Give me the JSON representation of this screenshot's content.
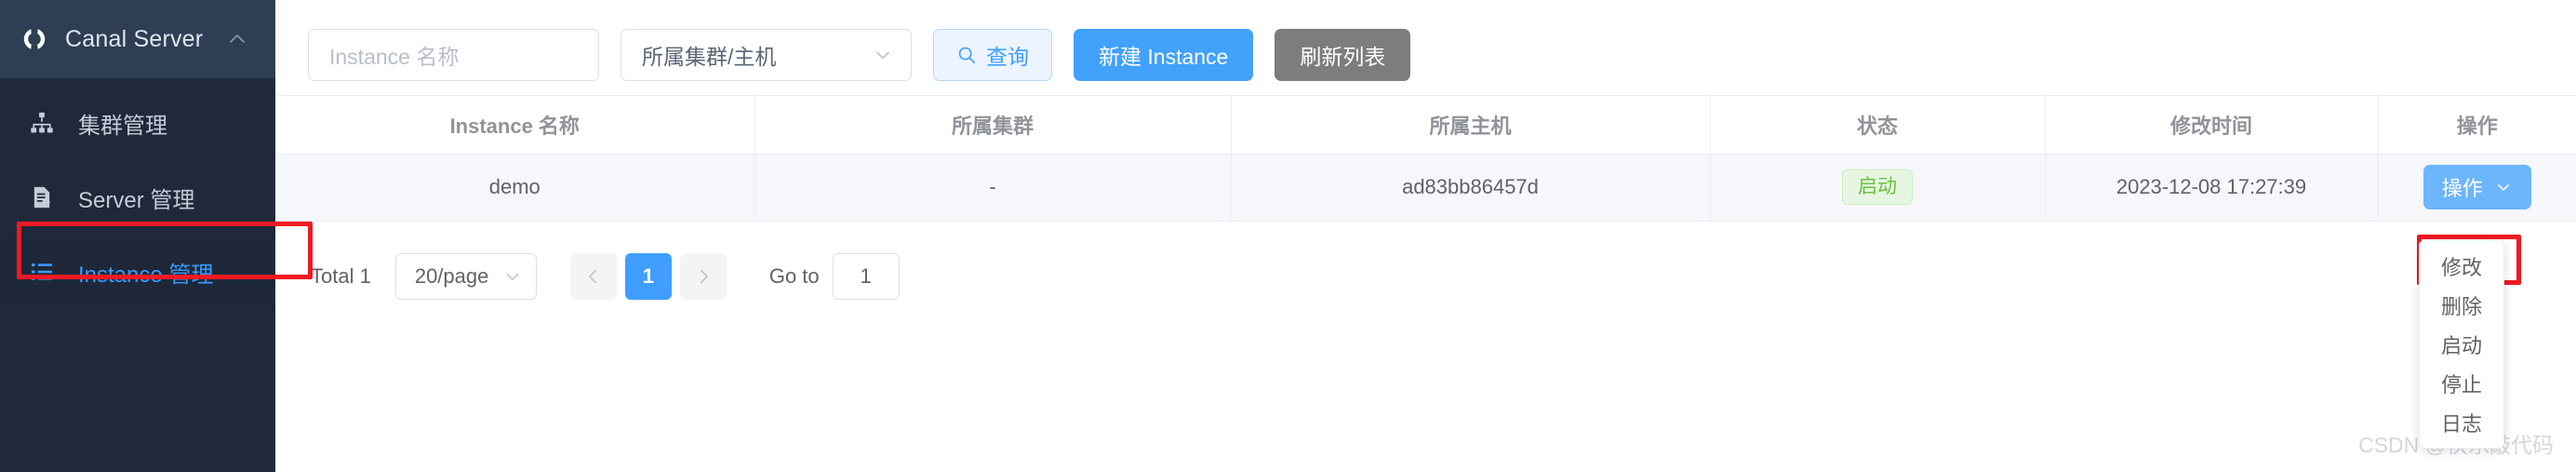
{
  "sidebar": {
    "brand": {
      "title": "Canal Server",
      "logo_icon": "canal-logo-icon",
      "collapse_icon": "chevron-up-icon"
    },
    "items": [
      {
        "label": "集群管理",
        "icon": "sitemap-icon",
        "active": false
      },
      {
        "label": "Server 管理",
        "icon": "document-edit-icon",
        "active": false
      },
      {
        "label": "Instance 管理",
        "icon": "list-icon",
        "active": true
      }
    ]
  },
  "toolbar": {
    "name_input_placeholder": "Instance 名称",
    "name_input_value": "",
    "cluster_select_value": "所属集群/主机",
    "query_label": "查询",
    "query_icon": "search-icon",
    "create_label": "新建 Instance",
    "refresh_label": "刷新列表"
  },
  "table": {
    "columns": [
      "Instance 名称",
      "所属集群",
      "所属主机",
      "状态",
      "修改时间",
      "操作"
    ],
    "rows": [
      {
        "name": "demo",
        "cluster": "-",
        "host": "ad83bb86457d",
        "status": "启动",
        "modified": "2023-12-08 17:27:39",
        "action_label": "操作",
        "action_caret_icon": "chevron-down-icon"
      }
    ]
  },
  "action_menu": {
    "items": [
      "修改",
      "删除",
      "启动",
      "停止",
      "日志"
    ]
  },
  "pagination": {
    "total_label": "Total 1",
    "page_size": "20/page",
    "page_size_caret_icon": "chevron-down-icon",
    "prev_icon": "chevron-left-icon",
    "next_icon": "chevron-right-icon",
    "current_page": "1",
    "goto_label": "Go to",
    "goto_value": "1"
  },
  "watermark": {
    "text": "CSDN @快乐敲代码"
  },
  "colors": {
    "sidebar_bg": "#20293a",
    "sidebar_header_bg": "#2e3e54",
    "accent_blue": "#409eff",
    "create_button_blue": "#41a1fb",
    "refresh_gray": "#7d7d7d",
    "status_green": "#67c23a",
    "annotation_red": "#ef1a23",
    "active_item_blue": "#3a9bff"
  }
}
